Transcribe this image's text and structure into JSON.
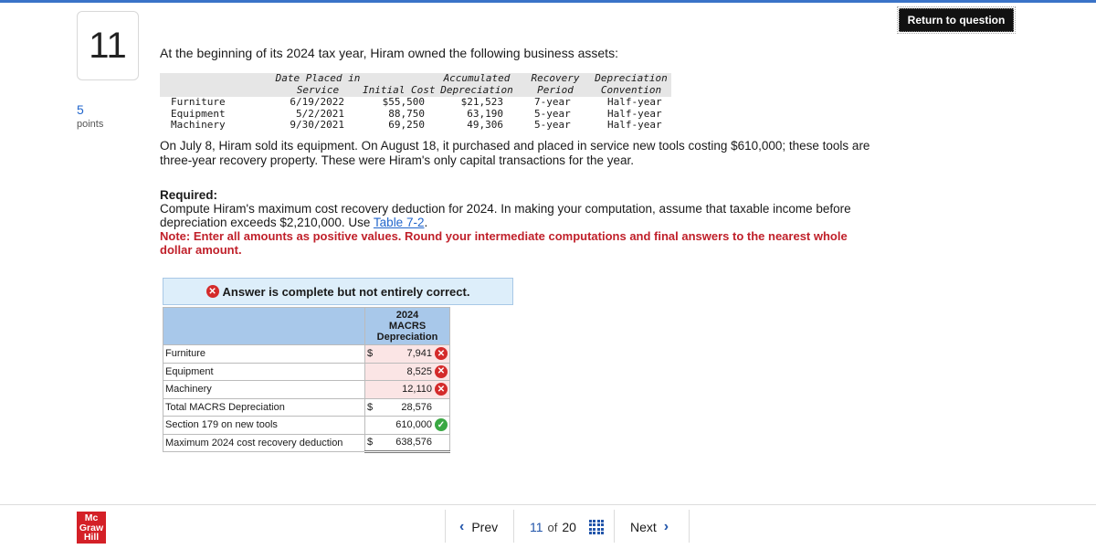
{
  "question": {
    "number": "11",
    "points_value": "5",
    "points_label": "points"
  },
  "header": {
    "return_label": "Return to question"
  },
  "problem": {
    "intro": "At the beginning of its 2024 tax year, Hiram owned the following business assets:",
    "asset_table": {
      "headers": {
        "date_line1": "Date Placed in",
        "date_line2": "Service",
        "cost": "Initial Cost",
        "accum_line1": "Accumulated",
        "accum_line2": "Depreciation",
        "recovery_line1": "Recovery",
        "recovery_line2": "Period",
        "conv_line1": "Depreciation",
        "conv_line2": "Convention"
      },
      "rows": [
        {
          "asset": "Furniture",
          "date": "6/19/2022",
          "cost": "$55,500",
          "accum": "$21,523",
          "period": "7-year",
          "convention": "Half-year"
        },
        {
          "asset": "Equipment",
          "date": "5/2/2021",
          "cost": "88,750",
          "accum": "63,190",
          "period": "5-year",
          "convention": "Half-year"
        },
        {
          "asset": "Machinery",
          "date": "9/30/2021",
          "cost": "69,250",
          "accum": "49,306",
          "period": "5-year",
          "convention": "Half-year"
        }
      ]
    },
    "paragraph": "On July 8, Hiram sold its equipment. On August 18, it purchased and placed in service new tools costing $610,000; these tools are three-year recovery property. These were Hiram's only capital transactions for the year.",
    "required_label": "Required:",
    "required_text_1": "Compute Hiram's maximum cost recovery deduction for 2024. In making your computation, assume that taxable income before depreciation exceeds $2,210,000. Use ",
    "required_link": "Table 7-2",
    "required_text_2": ".",
    "note": "Note: Enter all amounts as positive values. Round your intermediate computations and final answers to the nearest whole dollar amount."
  },
  "answer": {
    "banner": "Answer is complete but not entirely correct.",
    "column_header_1": "2024",
    "column_header_2": "MACRS",
    "column_header_3": "Depreciation",
    "rows": [
      {
        "label": "Furniture",
        "dollar": "$",
        "value": "7,941",
        "status": "incorrect"
      },
      {
        "label": "Equipment",
        "dollar": "",
        "value": "8,525",
        "status": "incorrect"
      },
      {
        "label": "Machinery",
        "dollar": "",
        "value": "12,110",
        "status": "incorrect"
      },
      {
        "label": "Total MACRS Depreciation",
        "dollar": "$",
        "value": "28,576",
        "status": ""
      },
      {
        "label": "Section 179 on new tools",
        "dollar": "",
        "value": "610,000",
        "status": "correct"
      },
      {
        "label": "Maximum 2024 cost recovery deduction",
        "dollar": "$",
        "value": "638,576",
        "status": ""
      }
    ]
  },
  "footer": {
    "logo_line1": "Mc",
    "logo_line2": "Graw",
    "logo_line3": "Hill",
    "prev_label": "Prev",
    "current_page": "11",
    "of_label": "of",
    "total_pages": "20",
    "next_label": "Next"
  }
}
